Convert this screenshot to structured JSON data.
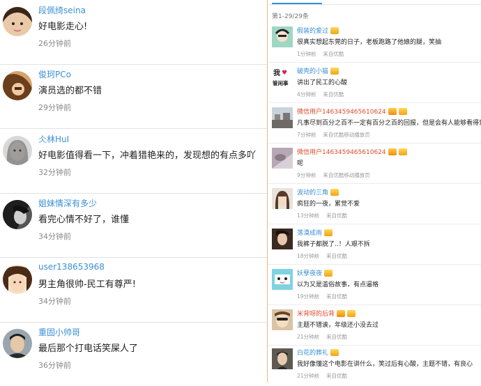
{
  "left_comments": [
    {
      "user": "段佩绮seina",
      "text": "好电影走心!",
      "time": "26分钟前"
    },
    {
      "user": "俊珂PCo",
      "text": "演员选的都不错",
      "time": "29分钟前"
    },
    {
      "user": "仌林HuI",
      "text": "好电影值得看一下，冲着猎艳来的，发现想的有点多吖",
      "time": "32分钟前"
    },
    {
      "user": "姐妹情深有多少",
      "text": "看完心情不好了，谁懂",
      "time": "34分钟前"
    },
    {
      "user": "user138653968",
      "text": "男主角很帅-民工有尊严!",
      "time": "34分钟前"
    },
    {
      "user": "重固小帅哥",
      "text": "最后那个打电话笑屎人了",
      "time": "36分钟前"
    }
  ],
  "right_panel": {
    "count_label": "第1-29/29条",
    "comments": [
      {
        "user": "假装的爱过",
        "text": "很真实想起东莞的日子，老板跑路了他娘的腿，笑抽",
        "time": "1分钟前",
        "source": "来自优酷",
        "name_color": "blue",
        "badges": [
          "vip"
        ]
      },
      {
        "user": "破壳的小猫",
        "text": "讲出了民工的心酸",
        "time": "4分钟前",
        "source": "来自优酷",
        "name_color": "blue",
        "badges": [
          "vip"
        ]
      },
      {
        "user": "微信用户1463459465610624",
        "text": "凡事尽到百分之百不一定有百分之百的回报，但是会有人能够看得到。",
        "time": "7分钟前",
        "source": "来自优酷移动播放页",
        "name_color": "red",
        "badges": [
          "crown",
          "vip"
        ]
      },
      {
        "user": "微信用户1463459465610624",
        "text": "呢",
        "time": "9分钟前",
        "source": "来自优酷移动播放页",
        "name_color": "red",
        "badges": [
          "crown",
          "vip"
        ]
      },
      {
        "user": "波动的三角",
        "text": "疯狂的一夜，累觉不爱",
        "time": "13分钟前",
        "source": "来自优酷",
        "name_color": "blue",
        "badges": [
          "vip"
        ]
      },
      {
        "user": "落漠成雨",
        "text": "我裤子都脱了..！人艰不拆",
        "time": "18分钟前",
        "source": "来自优酷",
        "name_color": "blue",
        "badges": [
          "vip"
        ]
      },
      {
        "user": "妖孽夜夜",
        "text": "以为又是滥俗故事，有点逼格",
        "time": "19分钟前",
        "source": "来自优酷",
        "name_color": "blue",
        "badges": [
          "vip"
        ]
      },
      {
        "user": "米背呀的后背",
        "text": "主题不错诶，年级还小没去过",
        "time": "21分钟前",
        "source": "来自优酷",
        "name_color": "red",
        "badges": [
          "crown",
          "vip"
        ]
      },
      {
        "user": "白花的葬礼",
        "text": "我好像懂这个电影在讲什么，笑过后有心酸，主题不错，有良心",
        "time": "21分钟前",
        "source": "来自优酷",
        "name_color": "blue",
        "badges": [
          "vip"
        ]
      }
    ]
  },
  "avatar_text": {
    "left": "我",
    "right": "管闲事"
  }
}
